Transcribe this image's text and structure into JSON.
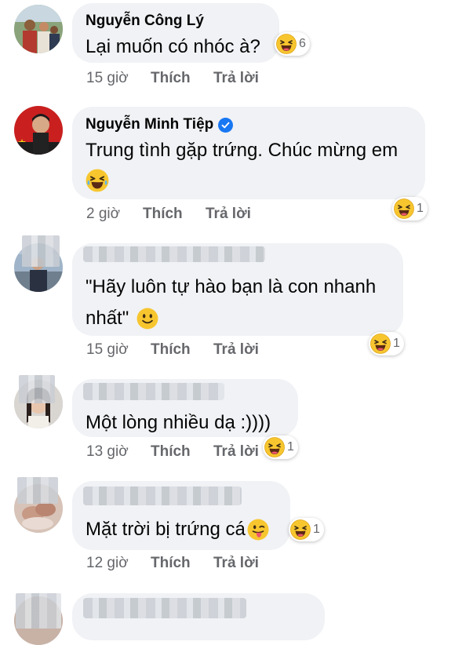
{
  "comments": [
    {
      "author": "Nguyễn Công Lý",
      "text": "Lại muốn có nhóc à?",
      "time": "15 giờ",
      "like": "Thích",
      "reply": "Trả lời",
      "reaction_count": "6"
    },
    {
      "author": "Nguyễn Minh Tiệp",
      "text": "Trung tình gặp trứng. Chúc mừng em",
      "time": "2 giờ",
      "like": "Thích",
      "reply": "Trả lời",
      "reaction_count": "1"
    },
    {
      "author": "",
      "text_line1": "\"Hãy luôn tự hào bạn là con nhanh",
      "text_line2": "nhất\"",
      "time": "15 giờ",
      "like": "Thích",
      "reply": "Trả lời",
      "reaction_count": "1"
    },
    {
      "author": "",
      "text": "Một lòng nhiều dạ :))))",
      "time": "13 giờ",
      "like": "Thích",
      "reply": "Trả lời",
      "reaction_count": "1"
    },
    {
      "author": "",
      "text": "Mặt trời bị trứng cá",
      "time": "12 giờ",
      "like": "Thích",
      "reply": "Trả lời",
      "reaction_count": "1"
    }
  ],
  "icons": {
    "reaction": "haha-emoji-icon",
    "verified": "verified-badge-icon"
  },
  "colors": {
    "bubble": "#f0f2f5",
    "meta_text": "#65676b",
    "verified": "#1877f2"
  }
}
